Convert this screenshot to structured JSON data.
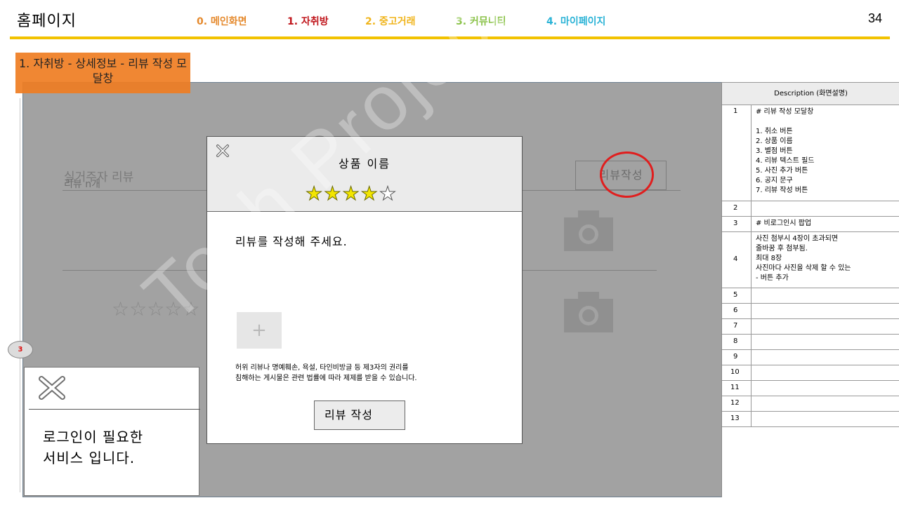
{
  "header": {
    "title": "홈페이지",
    "page_number": "34",
    "accent": "#f2c200",
    "nav": [
      {
        "label": "0. 메인화면",
        "color": "#e58a2e"
      },
      {
        "label": "1. 자취방",
        "color": "#c0161c"
      },
      {
        "label": "2. 중고거래",
        "color": "#f0b51d"
      },
      {
        "label": "3. 커뮤니티",
        "color": "#8bc34a"
      },
      {
        "label": "4. 마이페이지",
        "color": "#2bb3d6"
      }
    ]
  },
  "section_label": {
    "text": "1. 자취방 - 상세정보 - 리뷰 작성 모달창",
    "color": "#ef7d22"
  },
  "background_page": {
    "review_title": "실거주자 리뷰",
    "review_count": "리뷰 n개",
    "write_button": "리뷰작성",
    "stars": "☆☆☆☆☆",
    "camera_icons": [
      "camera-icon",
      "camera-icon"
    ]
  },
  "watermark": "Toch Project",
  "review_modal": {
    "close_icon": "close-icon",
    "product_name": "상품 이름",
    "rating": 4,
    "rating_max": 5,
    "rating_color": "#f3e600",
    "text_placeholder": "리뷰를 작성해 주세요.",
    "add_photo_icon": "plus-icon",
    "notice_line1": "허위 리뷰나 명예훼손, 욕설, 타인비방글 등 제3자의 권리를",
    "notice_line2": "침해하는 게시물은 관련 법률에 따라 제제를 받을 수 있습니다.",
    "submit_label": "리뷰 작성"
  },
  "marker": "3",
  "login_popup": {
    "close_icon": "close-icon",
    "line1": "로그인이 필요한",
    "line2": "서비스 입니다."
  },
  "description": {
    "header": "Description (화면설명)",
    "rows": [
      {
        "num": "1",
        "text": "# 리뷰 작성 모달창\n\n1. 취소 버튼\n2. 상품 이름\n3. 별점 버튼\n4. 리뷰 텍스트 필드\n5. 사진 추가 버튼\n6. 공지 문구\n7. 리뷰 작성 버튼"
      },
      {
        "num": "2",
        "text": ""
      },
      {
        "num": "3",
        "text": "# 비로그인시 팝업"
      },
      {
        "num": "4",
        "text": "사진 첨부시 4장이 초과되면\n줄바꿈 후 첨부됨.\n최대 8장\n사진마다 사진을 삭제 할 수 있는\n- 버튼 추가"
      },
      {
        "num": "5",
        "text": ""
      },
      {
        "num": "6",
        "text": ""
      },
      {
        "num": "7",
        "text": ""
      },
      {
        "num": "8",
        "text": ""
      },
      {
        "num": "9",
        "text": ""
      },
      {
        "num": "10",
        "text": ""
      },
      {
        "num": "11",
        "text": ""
      },
      {
        "num": "12",
        "text": ""
      },
      {
        "num": "13",
        "text": ""
      }
    ]
  }
}
